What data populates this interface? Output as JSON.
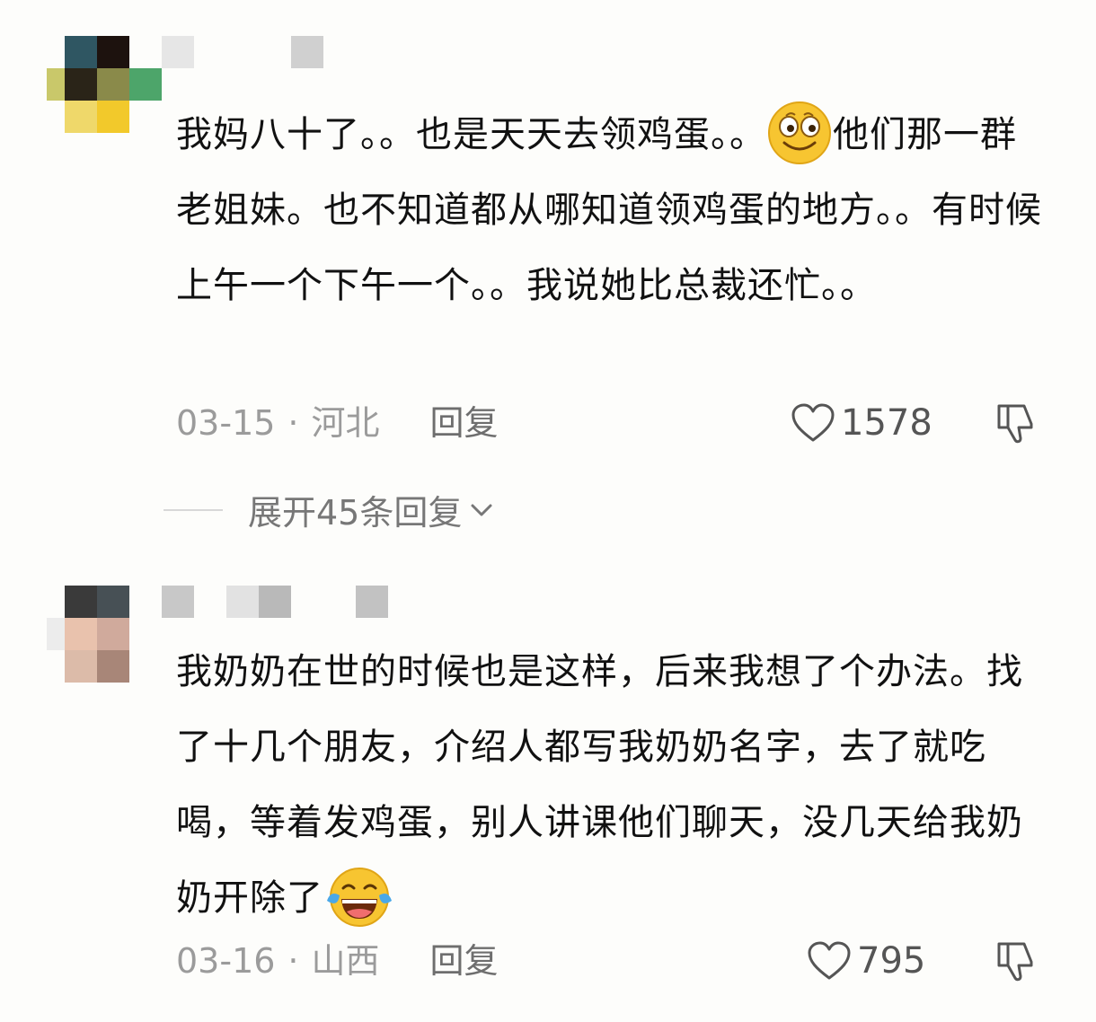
{
  "comments": [
    {
      "text_before_emoji": "我妈八十了。。也是天天去领鸡蛋。。",
      "emoji_icon": "grinning-face-icon",
      "text_after_emoji": "他们那一群老姐妹。也不知道都从哪知道领鸡蛋的地方。。有时候上午一个下午一个。。我说她比总裁还忙。。",
      "date": "03-15",
      "location": "河北",
      "reply_label": "回复",
      "likes": "1578",
      "expand_replies": "展开45条回复"
    },
    {
      "text_before_emoji": "我奶奶在世的时候也是这样，后来我想了个办法。找了十几个朋友，介绍人都写我奶奶名字，去了就吃喝，等着发鸡蛋，别人讲课他们聊天，没几天给我奶奶开除了",
      "emoji_icon": "laughing-tears-face-icon",
      "date": "03-16",
      "location": "山西",
      "reply_label": "回复",
      "likes": "795"
    }
  ],
  "icons": {
    "like": "heart-outline-icon",
    "dislike": "thumbs-down-icon",
    "expand": "chevron-down-icon"
  },
  "colors": {
    "background": "#fdfdfb",
    "text": "#111111",
    "meta": "#9b9b9b"
  }
}
